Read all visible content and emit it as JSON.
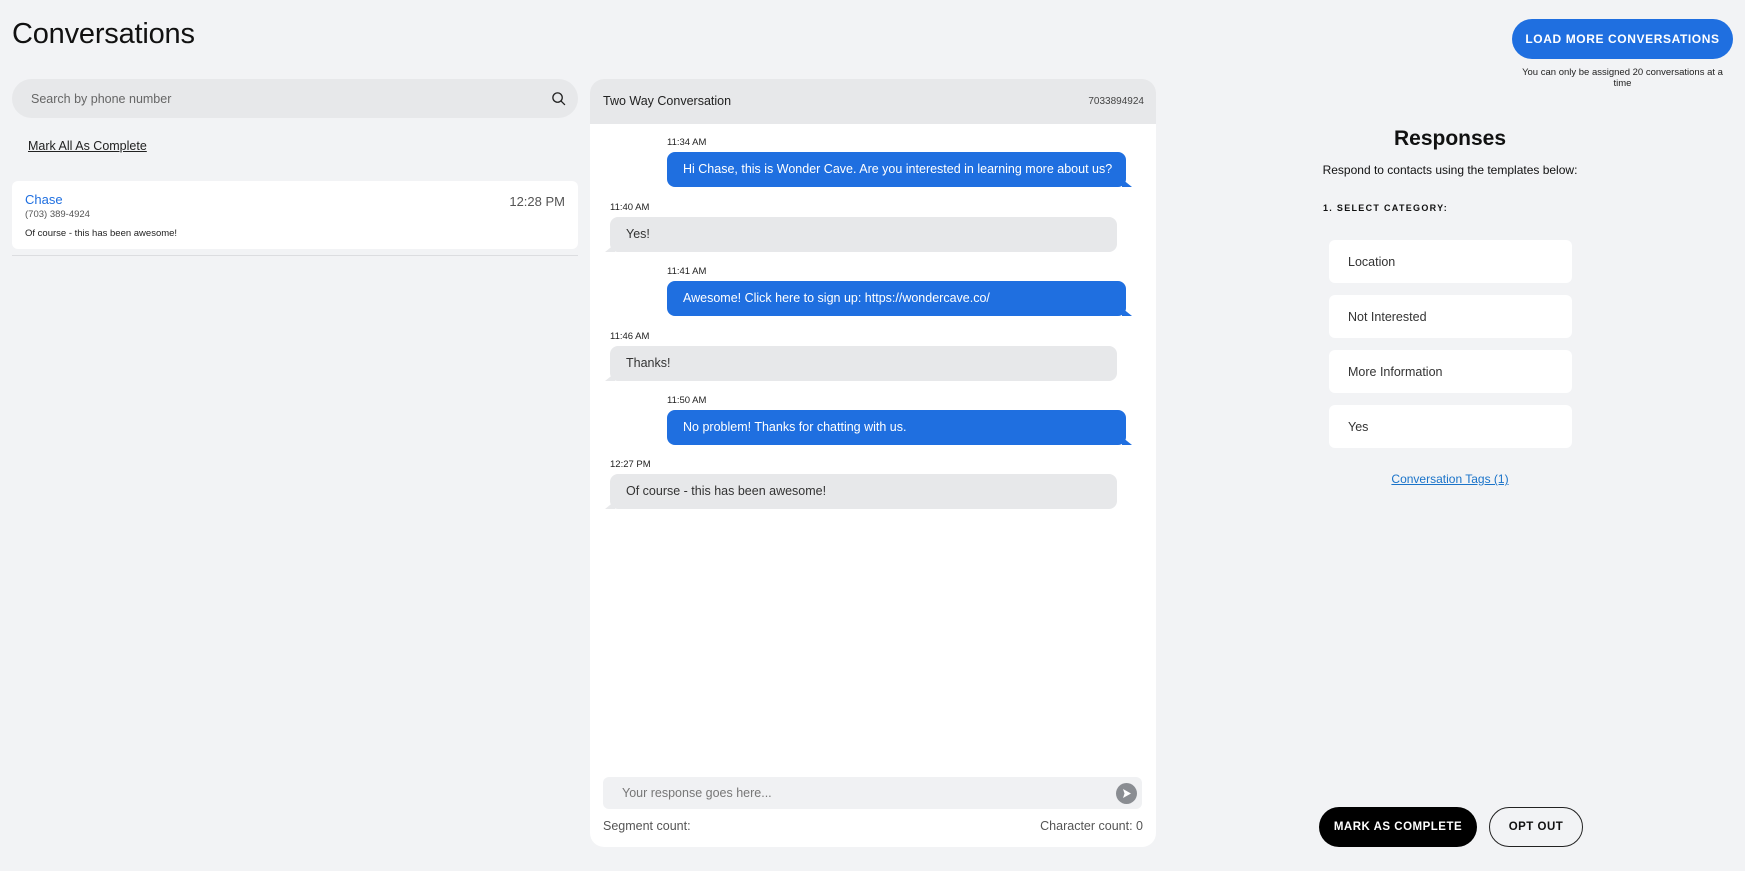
{
  "page": {
    "title": "Conversations",
    "load_more_label": "LOAD MORE CONVERSATIONS",
    "load_more_note": "You can only be assigned 20 conversations at a time"
  },
  "sidebar": {
    "search_placeholder": "Search by phone number",
    "search_icon": "search-icon",
    "mark_all_label": "Mark All As Complete",
    "conversations": [
      {
        "name": "Chase",
        "phone": "(703) 389-4924",
        "preview": "Of course - this has been awesome!",
        "time": "12:28 PM"
      }
    ]
  },
  "chat": {
    "title": "Two Way Conversation",
    "number": "7033894924",
    "messages": [
      {
        "direction": "out",
        "time": "11:34 AM",
        "text": "Hi Chase, this is Wonder Cave.  Are you interested in learning more  about us?"
      },
      {
        "direction": "in",
        "time": "11:40 AM",
        "text": "Yes!"
      },
      {
        "direction": "out",
        "time": "11:41 AM",
        "text": "Awesome!  Click here to sign up: https://wondercave.co/"
      },
      {
        "direction": "in",
        "time": "11:46 AM",
        "text": "Thanks!"
      },
      {
        "direction": "out",
        "time": "11:50 AM",
        "text": "No problem!  Thanks for chatting with us."
      },
      {
        "direction": "in",
        "time": "12:27 PM",
        "text": "Of course - this has been awesome!"
      }
    ],
    "reply_placeholder": "Your response goes here...",
    "send_icon": "send-icon",
    "segment_count_label": "Segment count:",
    "character_count_label": "Character count: 0"
  },
  "responses": {
    "title": "Responses",
    "subtitle": "Respond to contacts using the templates below:",
    "category_label": "1. SELECT CATEGORY:",
    "categories": [
      "Location",
      "Not Interested",
      "More Information",
      "Yes"
    ],
    "tags_link": "Conversation Tags (1)",
    "mark_complete_label": "MARK AS COMPLETE",
    "opt_out_label": "OPT OUT"
  },
  "colors": {
    "accent": "#1f6fe0",
    "background": "#f2f3f5",
    "bubble_in": "#e7e8ea"
  }
}
